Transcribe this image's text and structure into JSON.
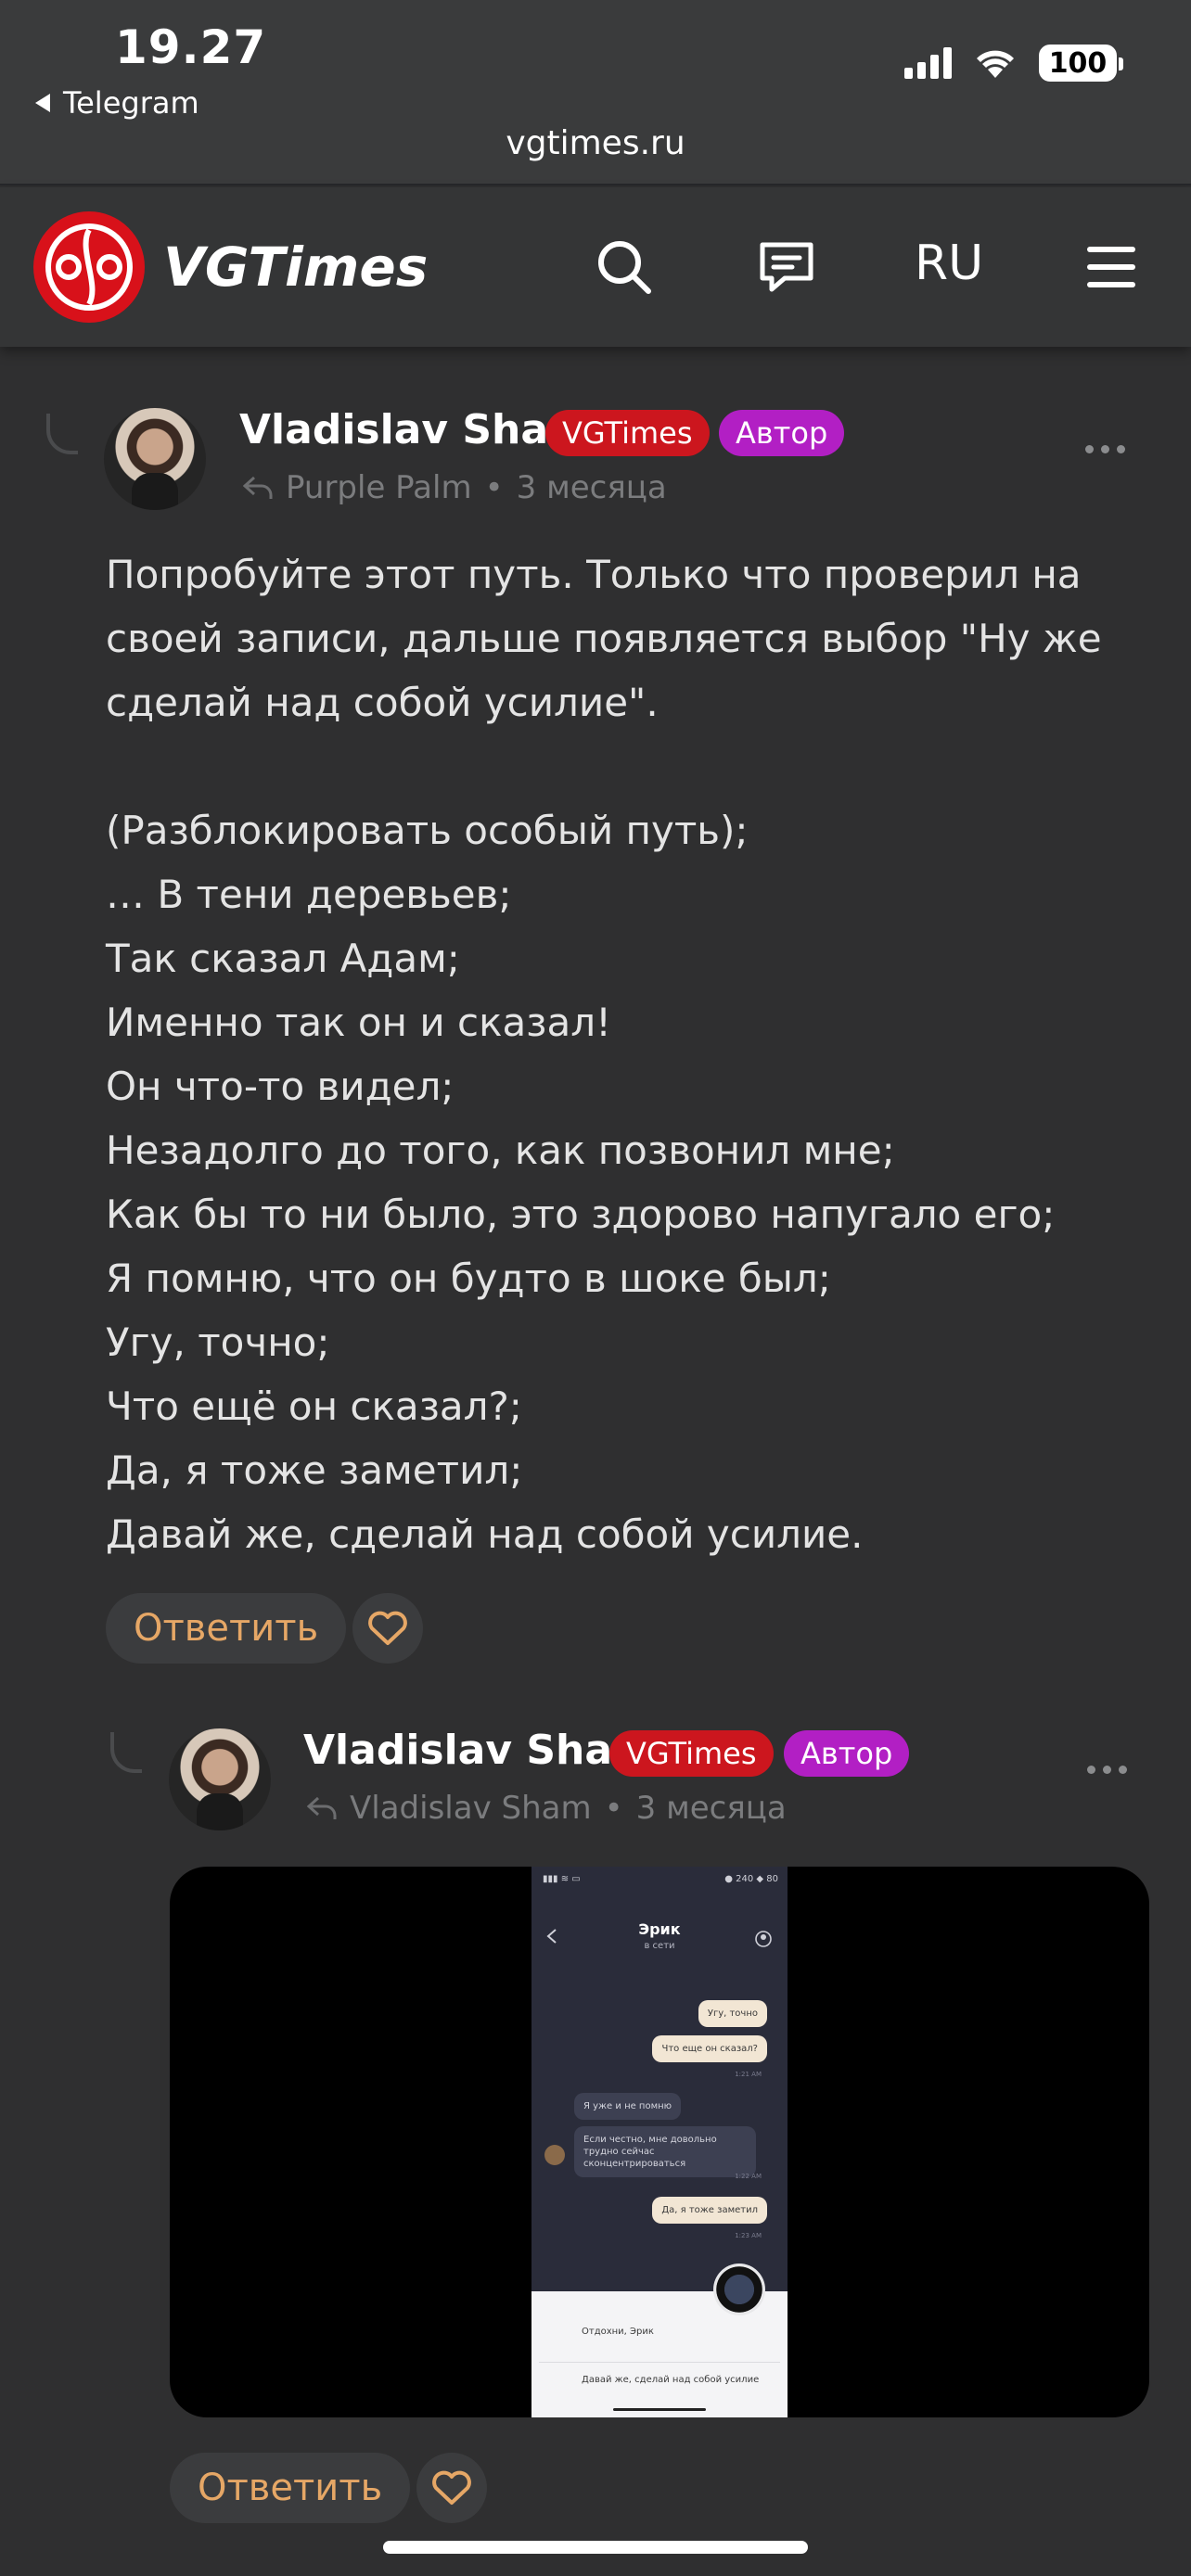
{
  "status_bar": {
    "time": "19.27",
    "back_app": "Telegram",
    "battery": "100",
    "url": "vgtimes.ru"
  },
  "header": {
    "logo_text": "VGTimes",
    "lang": "RU",
    "icons": [
      "search-icon",
      "messages-icon",
      "menu-icon"
    ]
  },
  "comments": [
    {
      "author": "Vladislav Sham",
      "badges": [
        "VGTimes",
        "Автор"
      ],
      "reply_to": "Purple Palm",
      "time": "3 месяца",
      "text": "Попробуйте этот путь. Только что проверил на\nсвоей записи, дальше появляется выбор \"Ну же\nсделай над собой усилие\".\n\n(Разблокировать особый путь);\n… В тени деревьев;\nТак сказал Адам;\nИменно так он и сказал!\nОн что-то видел;\nНезадолго до того, как позвонил мне;\nКак бы то ни было, это здорово напугало его;\nЯ помню, что он будто в шоке был;\nУгу, точно;\nЧто ещё он сказал?;\nДа, я тоже заметил;\nДавай же, сделай над собой усилие.",
      "reply_label": "Ответить"
    },
    {
      "author": "Vladislav Sham",
      "badges": [
        "VGTimes",
        "Автор"
      ],
      "reply_to": "Vladislav Sham",
      "time": "3 месяца",
      "reply_label": "Ответить",
      "media": {
        "status_right": "240",
        "status_right2": "80",
        "chat_title": "Эрик",
        "chat_status": "в сети",
        "messages": [
          {
            "dir": "out",
            "text": "Угу, точно"
          },
          {
            "dir": "out",
            "text": "Что еще он сказал?",
            "time": "1:21 AM"
          },
          {
            "dir": "in",
            "text": "Я уже и не помню"
          },
          {
            "dir": "in",
            "text": "Если честно, мне довольно трудно сейчас сконцентрироваться",
            "time": "1:22 AM"
          },
          {
            "dir": "out",
            "text": "Да, я тоже заметил",
            "time": "1:23 AM"
          }
        ],
        "options": [
          "Отдохни, Эрик",
          "Давай же, сделай над собой усилие"
        ]
      }
    }
  ],
  "colors": {
    "background": "#2f2f30",
    "accent_red": "#cc161e",
    "badge_purple": "#b21fc4",
    "reply_orange": "#e6a766"
  }
}
